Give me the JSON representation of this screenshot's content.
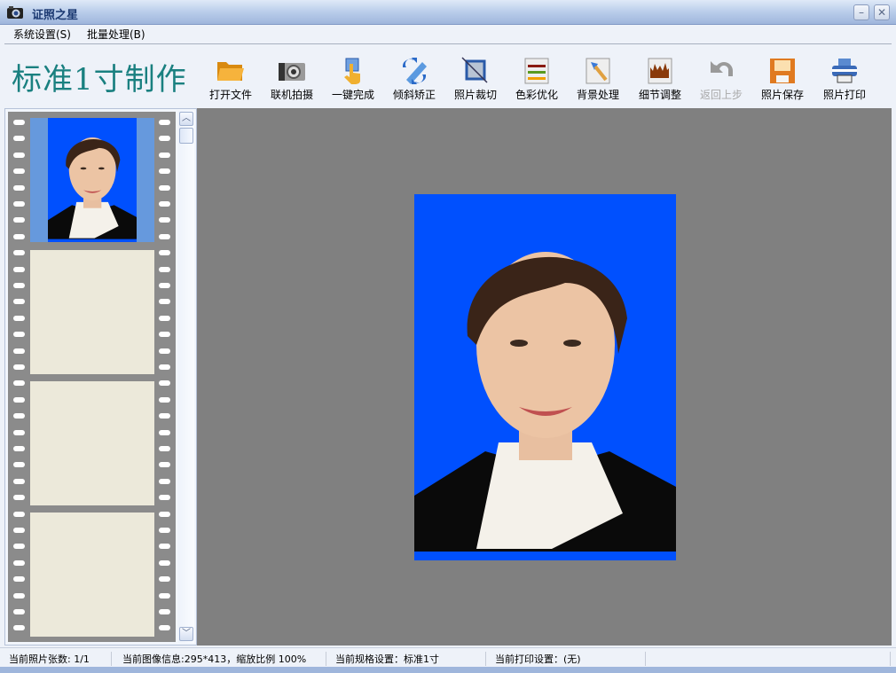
{
  "window": {
    "title": "证照之星",
    "minimize": "–",
    "close": "✕"
  },
  "menu": [
    {
      "label": "系统设置(S)"
    },
    {
      "label": "批量处理(B)"
    }
  ],
  "toolbar": {
    "brand": "标准1寸制作",
    "buttons": [
      {
        "label": "打开文件",
        "icon": "folder-open-icon"
      },
      {
        "label": "联机拍摄",
        "icon": "camera-icon"
      },
      {
        "label": "一键完成",
        "icon": "hand-pointer-icon"
      },
      {
        "label": "倾斜矫正",
        "icon": "rotate-icon"
      },
      {
        "label": "照片裁切",
        "icon": "crop-icon"
      },
      {
        "label": "色彩优化",
        "icon": "color-sliders-icon"
      },
      {
        "label": "背景处理",
        "icon": "brush-icon"
      },
      {
        "label": "细节调整",
        "icon": "histogram-icon"
      },
      {
        "label": "返回上步",
        "icon": "undo-icon",
        "disabled": true
      },
      {
        "label": "照片保存",
        "icon": "floppy-save-icon"
      },
      {
        "label": "照片打印",
        "icon": "printer-icon"
      }
    ]
  },
  "scroll": {
    "up": "︿",
    "down": "﹀"
  },
  "status": [
    {
      "label": "当前照片张数: 1/1"
    },
    {
      "label": "当前图像信息:295*413，缩放比例 100%"
    },
    {
      "label": "当前规格设置：标准1寸"
    },
    {
      "label": "当前打印设置：(无)"
    },
    {
      "label": ""
    }
  ],
  "colors": {
    "photo_bg": "#0050fe",
    "brand": "#1a8080"
  }
}
